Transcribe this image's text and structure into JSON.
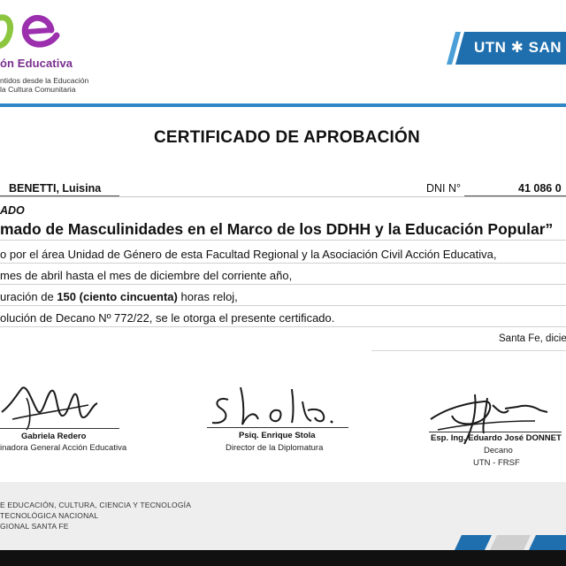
{
  "header": {
    "org_name": "ón Educativa",
    "org_tagline_1": "ntidos desde la Educación",
    "org_tagline_2": "la Cultura Comunitaria",
    "university_text": "UTN ✱ SAN"
  },
  "certificate": {
    "title": "CERTIFICADO DE APROBACIÓN",
    "recipient_name": "BENETTI, Luisina",
    "dni_label": "DNI N°",
    "dni_value": "41 086 0",
    "status": "ADO",
    "course": "mado de Masculinidades en el Marco de los DDHH y la Educación Popular”",
    "line1": "o por  el área Unidad de Género de esta Facultad Regional y la Asociación Civil Acción Educativa,",
    "line2": "mes de abril hasta el mes de diciembre del corriente año,",
    "line3_pre": "uración de ",
    "line3_bold": "150 (ciento cincuenta)",
    "line3_post": " horas reloj,",
    "line4": "olución de Decano Nº 772/22, se le otorga el presente certificado.",
    "place_date": "Santa Fe, dicie"
  },
  "signatures": [
    {
      "name": "Gabriela Redero",
      "role_1": "inadora General Acción Educativa",
      "role_2": ""
    },
    {
      "name": "Psiq. Enrique Stola",
      "role_1": "Director de la Diplomatura",
      "role_2": ""
    },
    {
      "name": "Esp. Ing. Eduardo José DONNET",
      "role_1": "Decano",
      "role_2": "UTN - FRSF"
    }
  ],
  "footer": {
    "line1": "E EDUCACIÓN, CULTURA, CIENCIA Y TECNOLOGÍA",
    "line2": "TECNOLÓGICA NACIONAL",
    "line3": "GIONAL SANTA FE"
  },
  "colors": {
    "brand_purple": "#7a2e8e",
    "brand_green": "#8cc63f",
    "utn_blue": "#1f6fae",
    "accent_blue": "#2f86c7"
  }
}
